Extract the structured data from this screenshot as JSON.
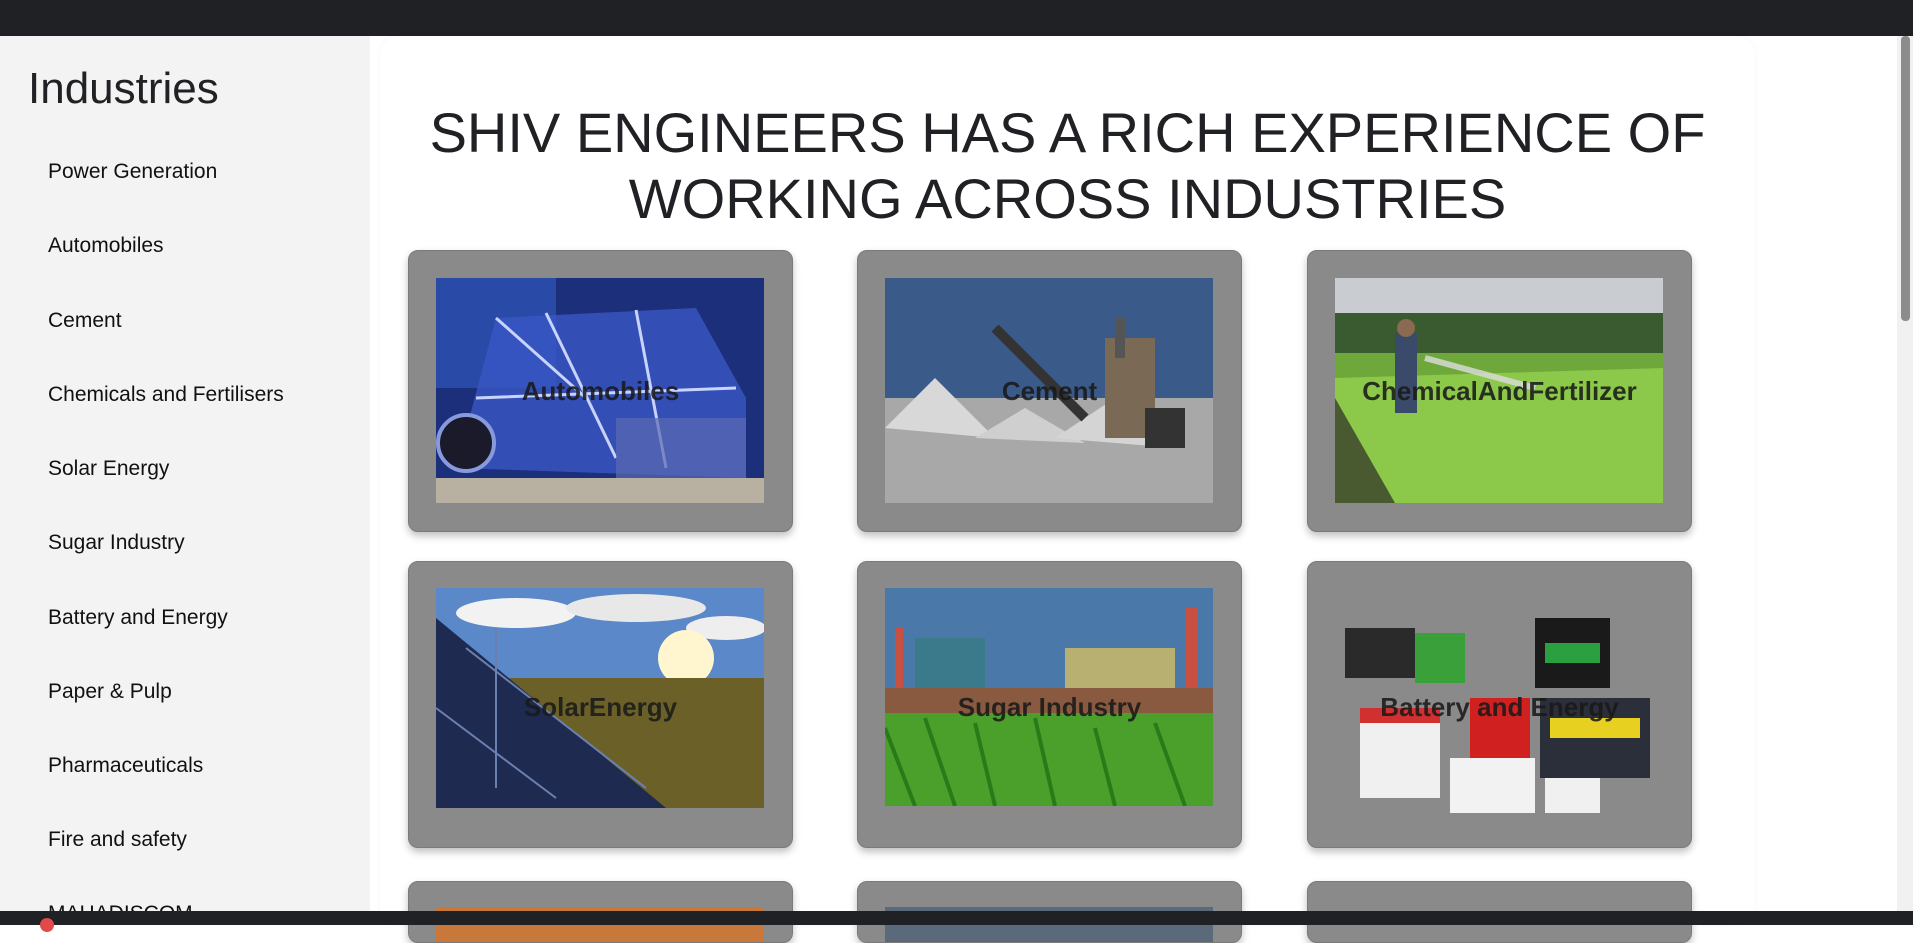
{
  "sidebar": {
    "title": "Industries",
    "items": [
      {
        "label": "Power Generation"
      },
      {
        "label": "Automobiles"
      },
      {
        "label": "Cement"
      },
      {
        "label": "Chemicals and Fertilisers"
      },
      {
        "label": "Solar Energy"
      },
      {
        "label": "Sugar Industry"
      },
      {
        "label": "Battery and Energy"
      },
      {
        "label": "Paper & Pulp"
      },
      {
        "label": "Pharmaceuticals"
      },
      {
        "label": "Fire and safety"
      },
      {
        "label": "MAHADISCOM"
      }
    ]
  },
  "main": {
    "heading_line1": "SHIV ENGINEERS HAS A RICH EXPERIENCE OF",
    "heading_line2": "WORKING ACROSS INDUSTRIES",
    "cards": [
      {
        "label": "Automobiles"
      },
      {
        "label": "Cement"
      },
      {
        "label": "ChemicalAndFertilizer"
      },
      {
        "label": "SolarEnergy"
      },
      {
        "label": "Sugar Industry"
      },
      {
        "label": "Battery and Energy"
      }
    ]
  },
  "colors": {
    "top_bar": "#202124",
    "sidebar_bg": "#f3f3f3",
    "card_bg": "#8a8a8a"
  }
}
